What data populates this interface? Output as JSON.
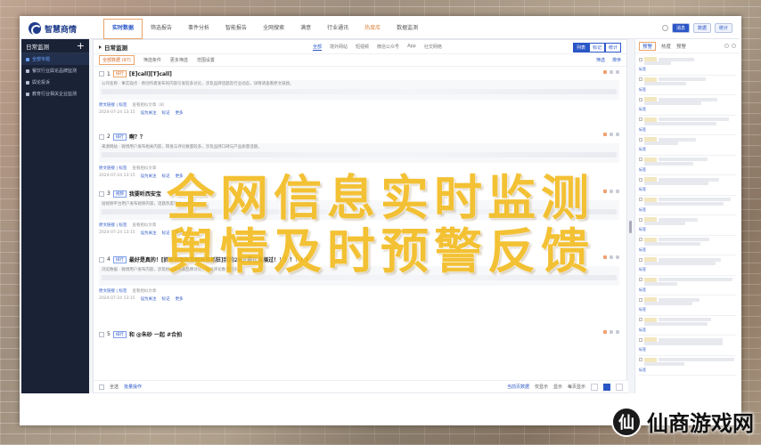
{
  "app": {
    "logo_text": "智慧商情"
  },
  "topnav": {
    "tabs": [
      {
        "label": "实时数据",
        "active": true
      },
      {
        "label": "筛选报告"
      },
      {
        "label": "事件分析"
      },
      {
        "label": "智能报告"
      },
      {
        "label": "全网搜索"
      },
      {
        "label": "满意"
      },
      {
        "label": "行业通讯"
      },
      {
        "label": "热度库",
        "warn": true
      },
      {
        "label": "数据监测"
      }
    ],
    "right_pills": [
      "消息",
      "数据",
      "统计"
    ]
  },
  "sidebar": {
    "title": "日常监测",
    "add_label": "+",
    "items": [
      {
        "label": "全部专题",
        "active": true
      },
      {
        "label": "餐饮行业舆论品牌监测"
      },
      {
        "label": "舆论投诉"
      },
      {
        "label": "教育行业相关企业监测"
      }
    ]
  },
  "main": {
    "title": "日常监测",
    "source_tabs": [
      "全部",
      "境外网站",
      "短视频",
      "微信公众号",
      "App",
      "社交网络"
    ],
    "view_toggle": [
      "列表",
      "标记",
      "统计"
    ],
    "filters": [
      "全部数据 (97)",
      "筛选条件",
      "更多筛选",
      "范围设置"
    ],
    "filter_right": [
      "筛选",
      "排序"
    ],
    "items": [
      {
        "num": "1",
        "tag": "排行",
        "title": "[E]call][T]call]",
        "body": "公司名称 · 事实观点 · 原创作者发布的内容引发较多讨论，涉及品牌话题及行业动态，详情请查看原文链接。",
        "meta": [
          "原文链接 | 标签",
          "查看相似文章（8）"
        ],
        "time": "2024-07-24 13:15",
        "actions": [
          "设为关注",
          "标记",
          "更多"
        ]
      },
      {
        "num": "2",
        "tag": "排行",
        "title": "啊？？",
        "body": "来源网站 · 微博用户发布相关内容，转发与评论数量较多，涉及品牌口碑与产品质量话题。",
        "meta": [
          "原文链接 | 标签",
          "查看相似文章"
        ],
        "time": "2024-07-24 13:15",
        "actions": [
          "设为关注",
          "标记",
          "更多"
        ]
      },
      {
        "num": "3",
        "tag": "视频",
        "title": "我要听西安宝",
        "body": "短视频平台用户发布视频内容，话题热度持续上升。",
        "meta": [
          "原文链接 | 标签",
          "查看相似文章"
        ],
        "time": "2024-07-24 13:15",
        "actions": [
          "设为关注",
          "标记",
          "更多"
        ]
      },
      {
        "num": "4",
        "tag": "排行",
        "title": "最好是真的！[抓狂][抓狂][抓狂][抓狂]我的26岁要在会展过！！！！！！！",
        "body": "浏览数据 · 微博用户发布内容，涉及相关事件及品牌讨论，转发评论数量较多。",
        "meta": [
          "原文链接 | 标签",
          "查看相似文章"
        ],
        "time": "2024-07-24 13:15",
        "actions": [
          "设为关注",
          "标记",
          "更多"
        ]
      },
      {
        "num": "5",
        "tag": "排行",
        "title": "和 @朱砂 一起 #合拍",
        "body": "",
        "meta": [],
        "time": "",
        "actions": []
      }
    ],
    "footer": {
      "select_all": "全选",
      "batch": "批量操作",
      "right_labels": [
        "当前页数据",
        "仅显示",
        "显示",
        "每页显示"
      ]
    }
  },
  "rpanel": {
    "tabs": [
      "预警",
      "热度",
      "预警"
    ],
    "items_count": 16,
    "item_tags": [
      "标签",
      "标签",
      "标签",
      "标签",
      "标签",
      "标签",
      "标签",
      "标签",
      "标签",
      "标签",
      "标签",
      "标签",
      "标签",
      "标签",
      "标签",
      "标签"
    ]
  },
  "overlay": {
    "line1": "全网信息实时监测",
    "line2": "舆情及时预警反馈"
  },
  "watermark": {
    "icon": "仙",
    "text": "仙商游戏网"
  }
}
